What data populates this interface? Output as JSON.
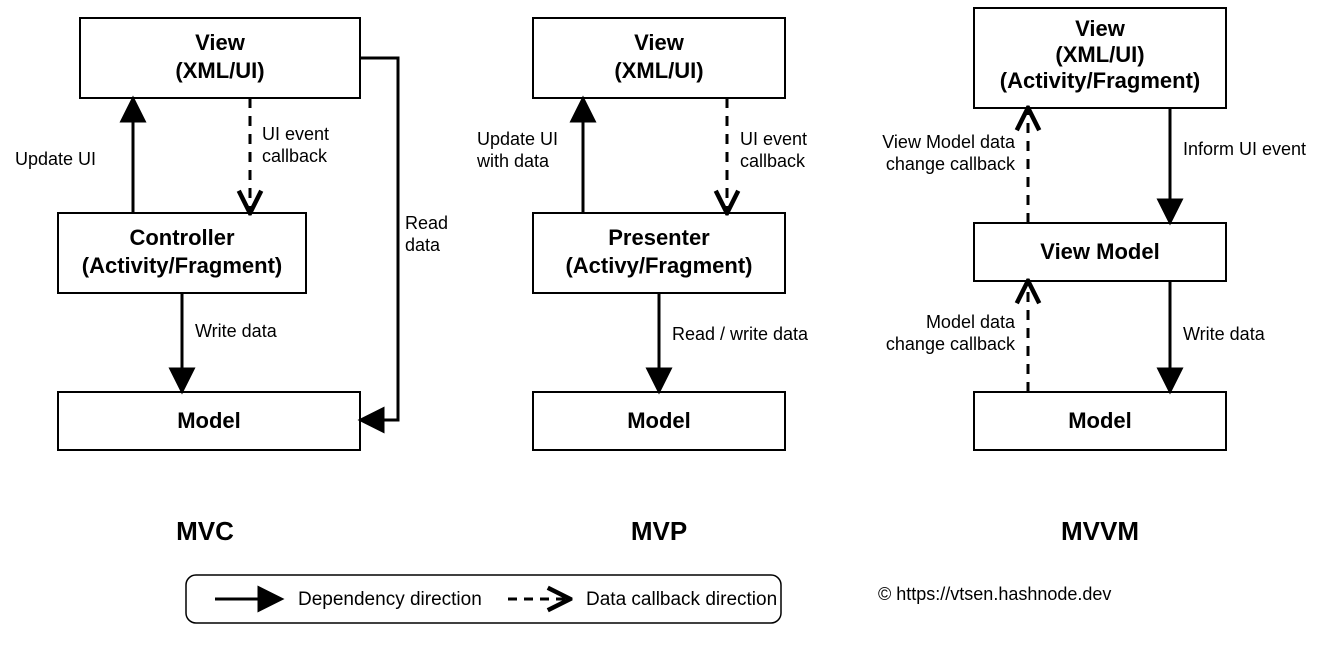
{
  "mvc": {
    "title": "MVC",
    "view_l1": "View",
    "view_l2": "(XML/UI)",
    "mid_l1": "Controller",
    "mid_l2": "(Activity/Fragment)",
    "model": "Model",
    "e_update": "Update UI",
    "e_callback_l1": "UI event",
    "e_callback_l2": "callback",
    "e_write": "Write data",
    "e_read_l1": "Read",
    "e_read_l2": "data"
  },
  "mvp": {
    "title": "MVP",
    "view_l1": "View",
    "view_l2": "(XML/UI)",
    "mid_l1": "Presenter",
    "mid_l2": "(Activy/Fragment)",
    "model": "Model",
    "e_update_l1": "Update UI",
    "e_update_l2": "with data",
    "e_callback_l1": "UI event",
    "e_callback_l2": "callback",
    "e_rw": "Read / write data"
  },
  "mvvm": {
    "title": "MVVM",
    "view_l1": "View",
    "view_l2": "(XML/UI)",
    "view_l3": "(Activity/Fragment)",
    "mid": "View Model",
    "model": "Model",
    "e_inform": "Inform UI event",
    "e_vmcb_l1": "View Model data",
    "e_vmcb_l2": "change callback",
    "e_write": "Write data",
    "e_mcb_l1": "Model data",
    "e_mcb_l2": "change callback"
  },
  "legend": {
    "dependency": "Dependency direction",
    "callback": "Data callback direction"
  },
  "copyright": "© https://vtsen.hashnode.dev"
}
